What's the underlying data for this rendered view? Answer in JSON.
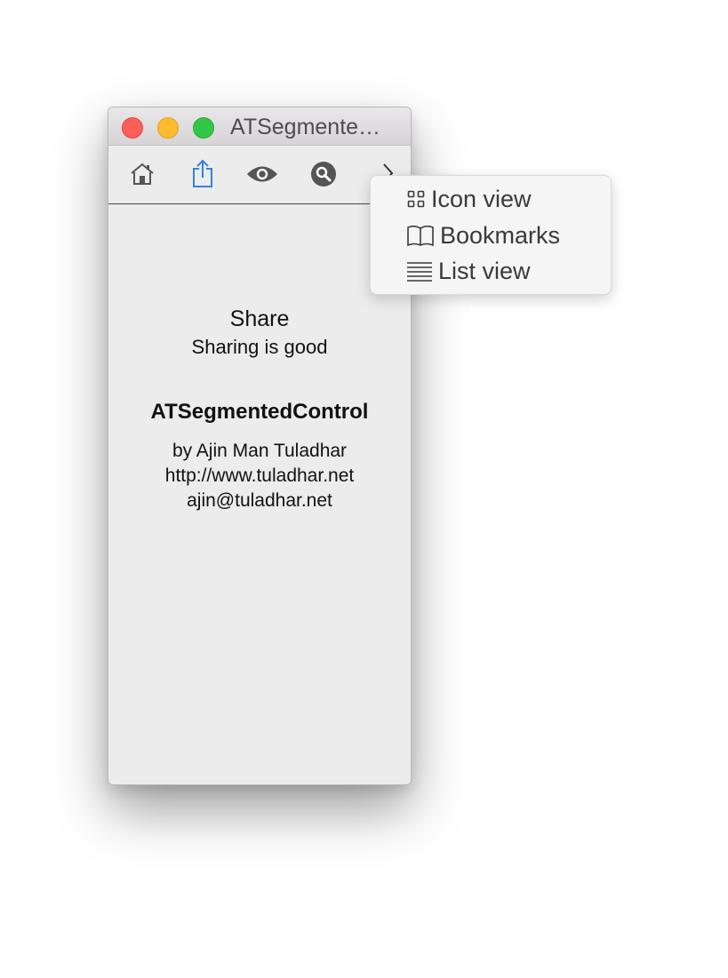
{
  "window": {
    "title": "ATSegmente…"
  },
  "toolbar": {
    "items": [
      {
        "name": "home",
        "icon": "home-icon"
      },
      {
        "name": "share",
        "icon": "share-icon",
        "selected": true,
        "accent": "#2f84e2"
      },
      {
        "name": "view",
        "icon": "eye-icon"
      },
      {
        "name": "search",
        "icon": "search-icon"
      },
      {
        "name": "more",
        "icon": "chevron-right-icon"
      }
    ]
  },
  "content": {
    "heading": "Share",
    "subheading": "Sharing is good",
    "app_name": "ATSegmentedControl",
    "author": "by Ajin Man Tuladhar",
    "website": "http://www.tuladhar.net",
    "email": "ajin@tuladhar.net"
  },
  "menu": {
    "items": [
      {
        "label": "Icon view",
        "icon": "grid-icon"
      },
      {
        "label": "Bookmarks",
        "icon": "book-icon"
      },
      {
        "label": "List view",
        "icon": "list-icon"
      }
    ]
  }
}
